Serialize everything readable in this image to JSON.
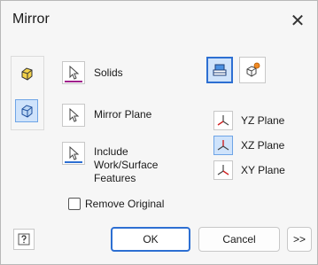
{
  "window": {
    "title": "Mirror",
    "close_glyph": "✕"
  },
  "mode_icons": [
    "mirror-features-icon",
    "mirror-solids-icon"
  ],
  "selectors": {
    "solids": {
      "label": "Solids",
      "icon": "select-cursor-icon",
      "accent": "#a0208c"
    },
    "mirror_plane": {
      "label": "Mirror Plane",
      "icon": "select-cursor-icon"
    },
    "include": {
      "label_lines": [
        "Include",
        "Work/Surface",
        "Features"
      ],
      "icon": "select-cursor-icon",
      "accent": "#2d6fd2"
    }
  },
  "operation_icons": [
    "new-body-icon",
    "join-icon"
  ],
  "planes": [
    {
      "label": "YZ Plane",
      "icon": "yz-plane-icon",
      "selected": false
    },
    {
      "label": "XZ Plane",
      "icon": "xz-plane-icon",
      "selected": true
    },
    {
      "label": "XY Plane",
      "icon": "xy-plane-icon",
      "selected": false
    }
  ],
  "remove_original": {
    "label": "Remove Original",
    "checked": false
  },
  "buttons": {
    "ok": "OK",
    "cancel": "Cancel",
    "more": ">>",
    "help_icon": "help-icon"
  },
  "colors": {
    "accent_blue": "#2d6fd2",
    "selected_bg": "#cfe3fb",
    "solids_bar": "#a0208c",
    "include_bar": "#2d6fd2"
  }
}
